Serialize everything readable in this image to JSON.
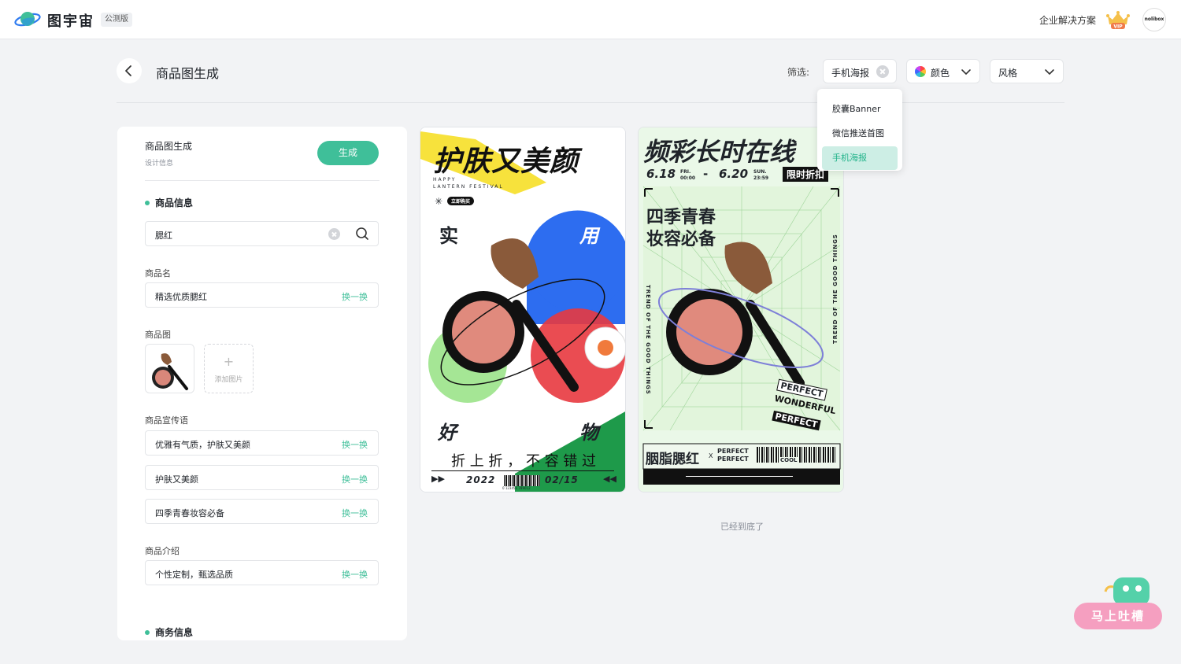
{
  "app": {
    "brand": "图宇宙",
    "beta_badge": "公测版",
    "enterprise_link": "企业解决方案",
    "vip_label": "VIP",
    "avatar_text": "nolibox"
  },
  "header": {
    "title": "商品图生成",
    "filter_label": "筛选:",
    "filter_type": "手机海报",
    "filter_color": "颜色",
    "filter_style": "风格"
  },
  "dropdown": {
    "items": [
      "胶囊Banner",
      "微信推送首图",
      "手机海报"
    ],
    "selected": "手机海报"
  },
  "panel": {
    "title": "商品图生成",
    "subtitle": "设计信息",
    "generate_label": "生成",
    "product_section": "商品信息",
    "search_value": "腮红",
    "name_label": "商品名",
    "name_value": "精选优质腮红",
    "swap_label": "换一换",
    "image_label": "商品图",
    "add_image_label": "添加图片",
    "slogan_label": "商品宣传语",
    "slogans": [
      "优雅有气质，护肤又美颜",
      "护肤又美颜",
      "四季青春妆容必备"
    ],
    "intro_label": "商品介绍",
    "intro_value": "个性定制，甄选品质",
    "business_section": "商务信息"
  },
  "poster1": {
    "headline": "护肤又美颜",
    "sub1": "HAPPY",
    "sub2": "LANTERN FESTIVAL",
    "buy_badge": "立即购买",
    "char_tl": "实",
    "char_tr": "用",
    "char_bl": "好",
    "char_br": "物",
    "tagline": "折 上 折 ， 不 容 错 过",
    "year": "2022",
    "date": "02/15",
    "barcode_num": "0 123456 789012"
  },
  "poster2": {
    "headline": "频彩长时在线",
    "date_start": "6.18",
    "date_start_day": "FRI.",
    "date_start_time": "00:00",
    "date_dash": "-",
    "date_end": "6.20",
    "date_end_day": "SUN.",
    "date_end_time": "23:59",
    "limited": "限时折扣",
    "slogan1": "四季青春",
    "slogan2": "妆容必备",
    "side_left": "TREND OF THE GOOD THINGS",
    "side_right": "TREND OF THE GOOD THINGS",
    "tag1": "PERFECT",
    "tag2": "WONDERFUL",
    "tag3": "PERFECT",
    "product_name": "胭脂腮红",
    "x_mark": "X",
    "perfect1": "PERFECT",
    "perfect2": "PERFECT",
    "cool": "COOL"
  },
  "feed": {
    "end_note": "已经到底了"
  },
  "feedback": {
    "label": "马上吐槽"
  },
  "colors": {
    "accent": "#3fbf99",
    "accent_light": "#cdeee5",
    "feedback_pink": "#f59fc0"
  }
}
